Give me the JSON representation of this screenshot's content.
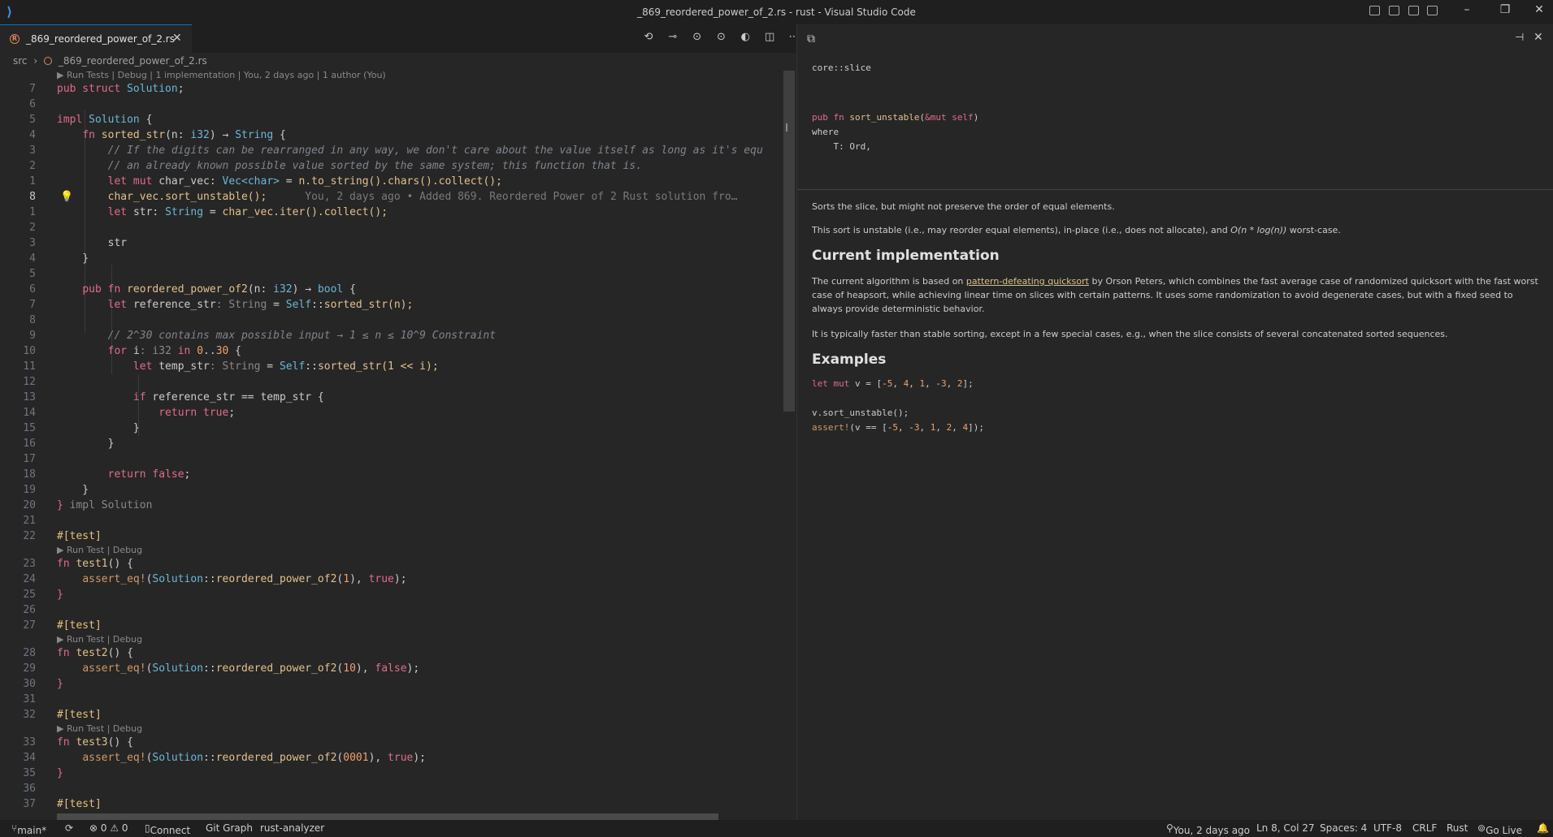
{
  "window": {
    "title": "_869_reordered_power_of_2.rs - rust - Visual Studio Code"
  },
  "tabs": [
    {
      "label": "_869_reordered_power_of_2.rs"
    }
  ],
  "breadcrumb": {
    "folder": "src",
    "file": "_869_reordered_power_of_2.rs"
  },
  "editor": {
    "codelens_top": "▶ Run Tests | Debug | 1 implementation | You, 2 days ago | 1 author (You)",
    "codelens_test": "▶ Run Test | Debug",
    "blame": "You, 2 days ago • Added 869. Reordered Power of 2 Rust solution fro…",
    "line_numbers": [
      "7",
      "6",
      "5",
      "4",
      "3",
      "2",
      "1",
      "8",
      "1",
      "2",
      "3",
      "4",
      "5",
      "6",
      "7",
      "8",
      "9",
      "10",
      "11",
      "12",
      "13",
      "14",
      "15",
      "16",
      "17",
      "18",
      "19",
      "20",
      "21",
      "22",
      "23",
      "24",
      "25",
      "26",
      "27",
      "28",
      "29",
      "30",
      "31",
      "32",
      "33",
      "34",
      "35",
      "36",
      "37"
    ],
    "lines": {
      "l7": "Solution",
      "impl_name": "Solution",
      "fn_sorted": "sorted_str",
      "comment1": "// If the digits can be rearranged in any way, we don't care about the value itself as long as it's equ",
      "comment2": "// an already known possible value sorted by the same system; this function that is.",
      "charvec_decl": "char_vec",
      "vec_type": "Vec<char>",
      "to_string": "n.to_string().chars().collect();",
      "sort_call": "char_vec.sort_unstable();",
      "str_decl": "str",
      "str_type": "String",
      "str_rhs": "char_vec.iter().collect();",
      "str_ret": "str",
      "fn_reordered": "reordered_power_of2",
      "ref_decl": "reference_str",
      "ref_rhs": "sorted_str(n);",
      "comment3": "// 2^30 contains max possible input → 1 ≤ n ≤ 10^9 Constraint",
      "for_var": "i",
      "tmp_decl": "temp_str",
      "tmp_rhs": "sorted_str(1 << i);",
      "if_cond": "reference_str == temp_str",
      "impl_end_hint": "impl Solution",
      "attr_test": "#[test]",
      "test1": "test1",
      "test2": "test2",
      "test3": "test3",
      "assert1_arg": "1",
      "assert2_arg": "10",
      "assert3_arg": "0001"
    }
  },
  "hover": {
    "module": "core::slice",
    "sig_line1": "pub fn sort_unstable(&mut self)",
    "sig_line2": "where",
    "sig_line3": "    T: Ord,",
    "p1": "Sorts the slice, but might not preserve the order of equal elements.",
    "p2_a": "This sort is unstable (i.e., may reorder equal elements), in-place (i.e., does not allocate), and ",
    "p2_b": "O(n * log(n))",
    "p2_c": " worst-case.",
    "h1": "Current implementation",
    "p3_a": "The current algorithm is based on ",
    "p3_link": "pattern-defeating quicksort",
    "p3_b": " by Orson Peters, which combines the fast average case of randomized quicksort with the fast worst case of heapsort, while achieving linear time on slices with certain patterns. It uses some randomization to avoid degenerate cases, but with a fixed seed to always provide deterministic behavior.",
    "p4": "It is typically faster than stable sorting, except in a few special cases, e.g., when the slice consists of several concatenated sorted sequences.",
    "h2": "Examples",
    "ex1": "let mut v = [-5, 4, 1, -3, 2];",
    "ex2": "v.sort_unstable();",
    "ex3": "assert!(v == [-5, -3, 1, 2, 4]);"
  },
  "statusbar": {
    "branch": "main*",
    "errors": "⊗ 0 ⚠ 0",
    "connect": "Connect",
    "git_graph": "Git Graph",
    "analyzer": "rust-analyzer",
    "blame": "You, 2 days ago",
    "position": "Ln 8, Col 27",
    "spaces": "Spaces: 4",
    "encoding": "UTF-8",
    "eol": "CRLF",
    "language": "Rust",
    "golive": "Go Live"
  }
}
